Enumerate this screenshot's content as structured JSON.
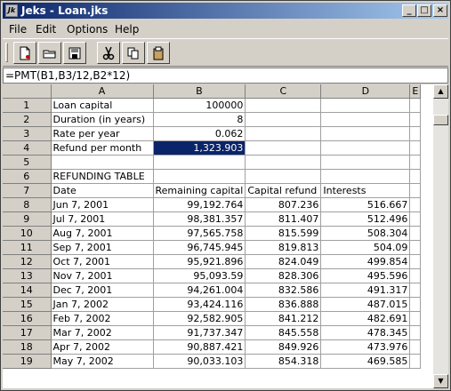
{
  "window": {
    "title": "Jeks - Loan.jks",
    "app_icon": "Jk"
  },
  "menu": [
    "File",
    "Edit",
    "Options",
    "Help"
  ],
  "toolbar": [
    {
      "name": "new-document-icon"
    },
    {
      "name": "open-folder-icon"
    },
    {
      "name": "save-disk-icon"
    },
    {
      "name": "cut-scissors-icon"
    },
    {
      "name": "copy-icon"
    },
    {
      "name": "paste-clipboard-icon"
    }
  ],
  "formula": "=PMT(B1,B3/12,B2*12)",
  "columns": [
    "A",
    "B",
    "C",
    "D",
    "E"
  ],
  "rows": [
    {
      "n": "1",
      "a": "Loan capital",
      "b": "100000",
      "c": "",
      "d": ""
    },
    {
      "n": "2",
      "a": "Duration (in years)",
      "b": "8",
      "c": "",
      "d": ""
    },
    {
      "n": "3",
      "a": "Rate per year",
      "b": "0.062",
      "c": "",
      "d": ""
    },
    {
      "n": "4",
      "a": "Refund per month",
      "b": "1,323.903",
      "c": "",
      "d": ""
    },
    {
      "n": "5",
      "a": "",
      "b": "",
      "c": "",
      "d": ""
    },
    {
      "n": "6",
      "a": "REFUNDING TABLE",
      "b": "",
      "c": "",
      "d": ""
    },
    {
      "n": "7",
      "a": "Date",
      "b": "Remaining capital",
      "c": "Capital refund",
      "d": "Interests"
    },
    {
      "n": "8",
      "a": "Jun 7, 2001",
      "b": "99,192.764",
      "c": "807.236",
      "d": "516.667"
    },
    {
      "n": "9",
      "a": "Jul 7, 2001",
      "b": "98,381.357",
      "c": "811.407",
      "d": "512.496"
    },
    {
      "n": "10",
      "a": "Aug 7, 2001",
      "b": "97,565.758",
      "c": "815.599",
      "d": "508.304"
    },
    {
      "n": "11",
      "a": "Sep 7, 2001",
      "b": "96,745.945",
      "c": "819.813",
      "d": "504.09"
    },
    {
      "n": "12",
      "a": "Oct 7, 2001",
      "b": "95,921.896",
      "c": "824.049",
      "d": "499.854"
    },
    {
      "n": "13",
      "a": "Nov 7, 2001",
      "b": "95,093.59",
      "c": "828.306",
      "d": "495.596"
    },
    {
      "n": "14",
      "a": "Dec 7, 2001",
      "b": "94,261.004",
      "c": "832.586",
      "d": "491.317"
    },
    {
      "n": "15",
      "a": "Jan 7, 2002",
      "b": "93,424.116",
      "c": "836.888",
      "d": "487.015"
    },
    {
      "n": "16",
      "a": "Feb 7, 2002",
      "b": "92,582.905",
      "c": "841.212",
      "d": "482.691"
    },
    {
      "n": "17",
      "a": "Mar 7, 2002",
      "b": "91,737.347",
      "c": "845.558",
      "d": "478.345"
    },
    {
      "n": "18",
      "a": "Apr 7, 2002",
      "b": "90,887.421",
      "c": "849.926",
      "d": "473.976"
    },
    {
      "n": "19",
      "a": "May 7, 2002",
      "b": "90,033.103",
      "c": "854.318",
      "d": "469.585"
    }
  ],
  "selected_cell": "B4",
  "colors": {
    "title_start": "#0a246a",
    "title_end": "#a6caf0",
    "selection": "#0a246a"
  }
}
